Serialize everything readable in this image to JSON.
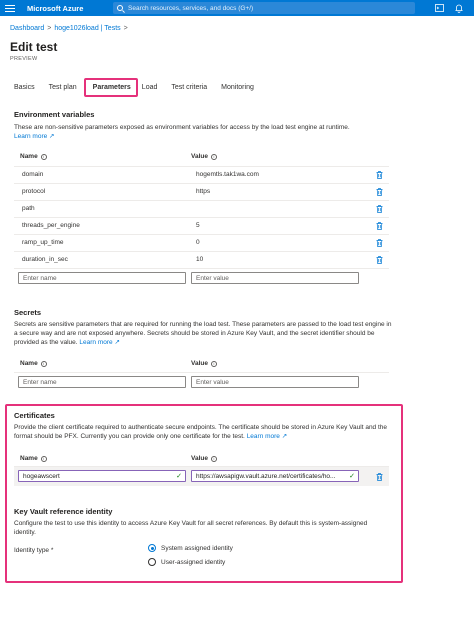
{
  "topbar": {
    "brand": "Microsoft Azure",
    "search_placeholder": "Search resources, services, and docs (G+/)"
  },
  "breadcrumb": {
    "items": [
      "Dashboard",
      "hoge1026load | Tests"
    ],
    "separator": ">"
  },
  "page": {
    "title": "Edit test",
    "subtitle": "PREVIEW"
  },
  "tabs": [
    {
      "label": "Basics",
      "active": false
    },
    {
      "label": "Test plan",
      "active": false
    },
    {
      "label": "Parameters",
      "active": true
    },
    {
      "label": "Load",
      "active": false
    },
    {
      "label": "Test criteria",
      "active": false
    },
    {
      "label": "Monitoring",
      "active": false
    }
  ],
  "env": {
    "title": "Environment variables",
    "description": "These are non-sensitive parameters exposed as environment variables for access by the load test engine at runtime.",
    "learn_more": "Learn more",
    "col_name": "Name",
    "col_value": "Value",
    "rows": [
      {
        "name": "domain",
        "value": "hogemtls.tak1wa.com"
      },
      {
        "name": "protocol",
        "value": "https"
      },
      {
        "name": "path",
        "value": ""
      },
      {
        "name": "threads_per_engine",
        "value": "5"
      },
      {
        "name": "ramp_up_time",
        "value": "0"
      },
      {
        "name": "duration_in_sec",
        "value": "10"
      }
    ],
    "name_placeholder": "Enter name",
    "value_placeholder": "Enter value"
  },
  "secrets": {
    "title": "Secrets",
    "description": "Secrets are sensitive parameters that are required for running the load test. These parameters are passed to the load test engine in a secure way and are not exposed anywhere. Secrets should be stored in Azure Key Vault, and the secret identifier should be provided as the value.",
    "learn_more": "Learn more",
    "col_name": "Name",
    "col_value": "Value",
    "name_placeholder": "Enter name",
    "value_placeholder": "Enter value"
  },
  "certificates": {
    "title": "Certificates",
    "description": "Provide the client certificate required to authenticate secure endpoints. The certificate should be stored in Azure Key Vault and the format should be PFX. Currently you can provide only one certificate for the test.",
    "learn_more": "Learn more",
    "col_name": "Name",
    "col_value": "Value",
    "name_value": "hogeawscert",
    "value_value": "https://awsapigw.vault.azure.net/certificates/ho..."
  },
  "keyvault": {
    "title": "Key Vault reference identity",
    "description": "Configure the test to use this identity to access Azure Key Vault for all secret references. By default this is system-assigned identity.",
    "identity_label": "Identity type *",
    "options": [
      {
        "label": "System assigned identity",
        "checked": true
      },
      {
        "label": "User-assigned identity",
        "checked": false
      }
    ]
  },
  "colors": {
    "accent": "#0078d4",
    "highlight": "#e5317b"
  }
}
